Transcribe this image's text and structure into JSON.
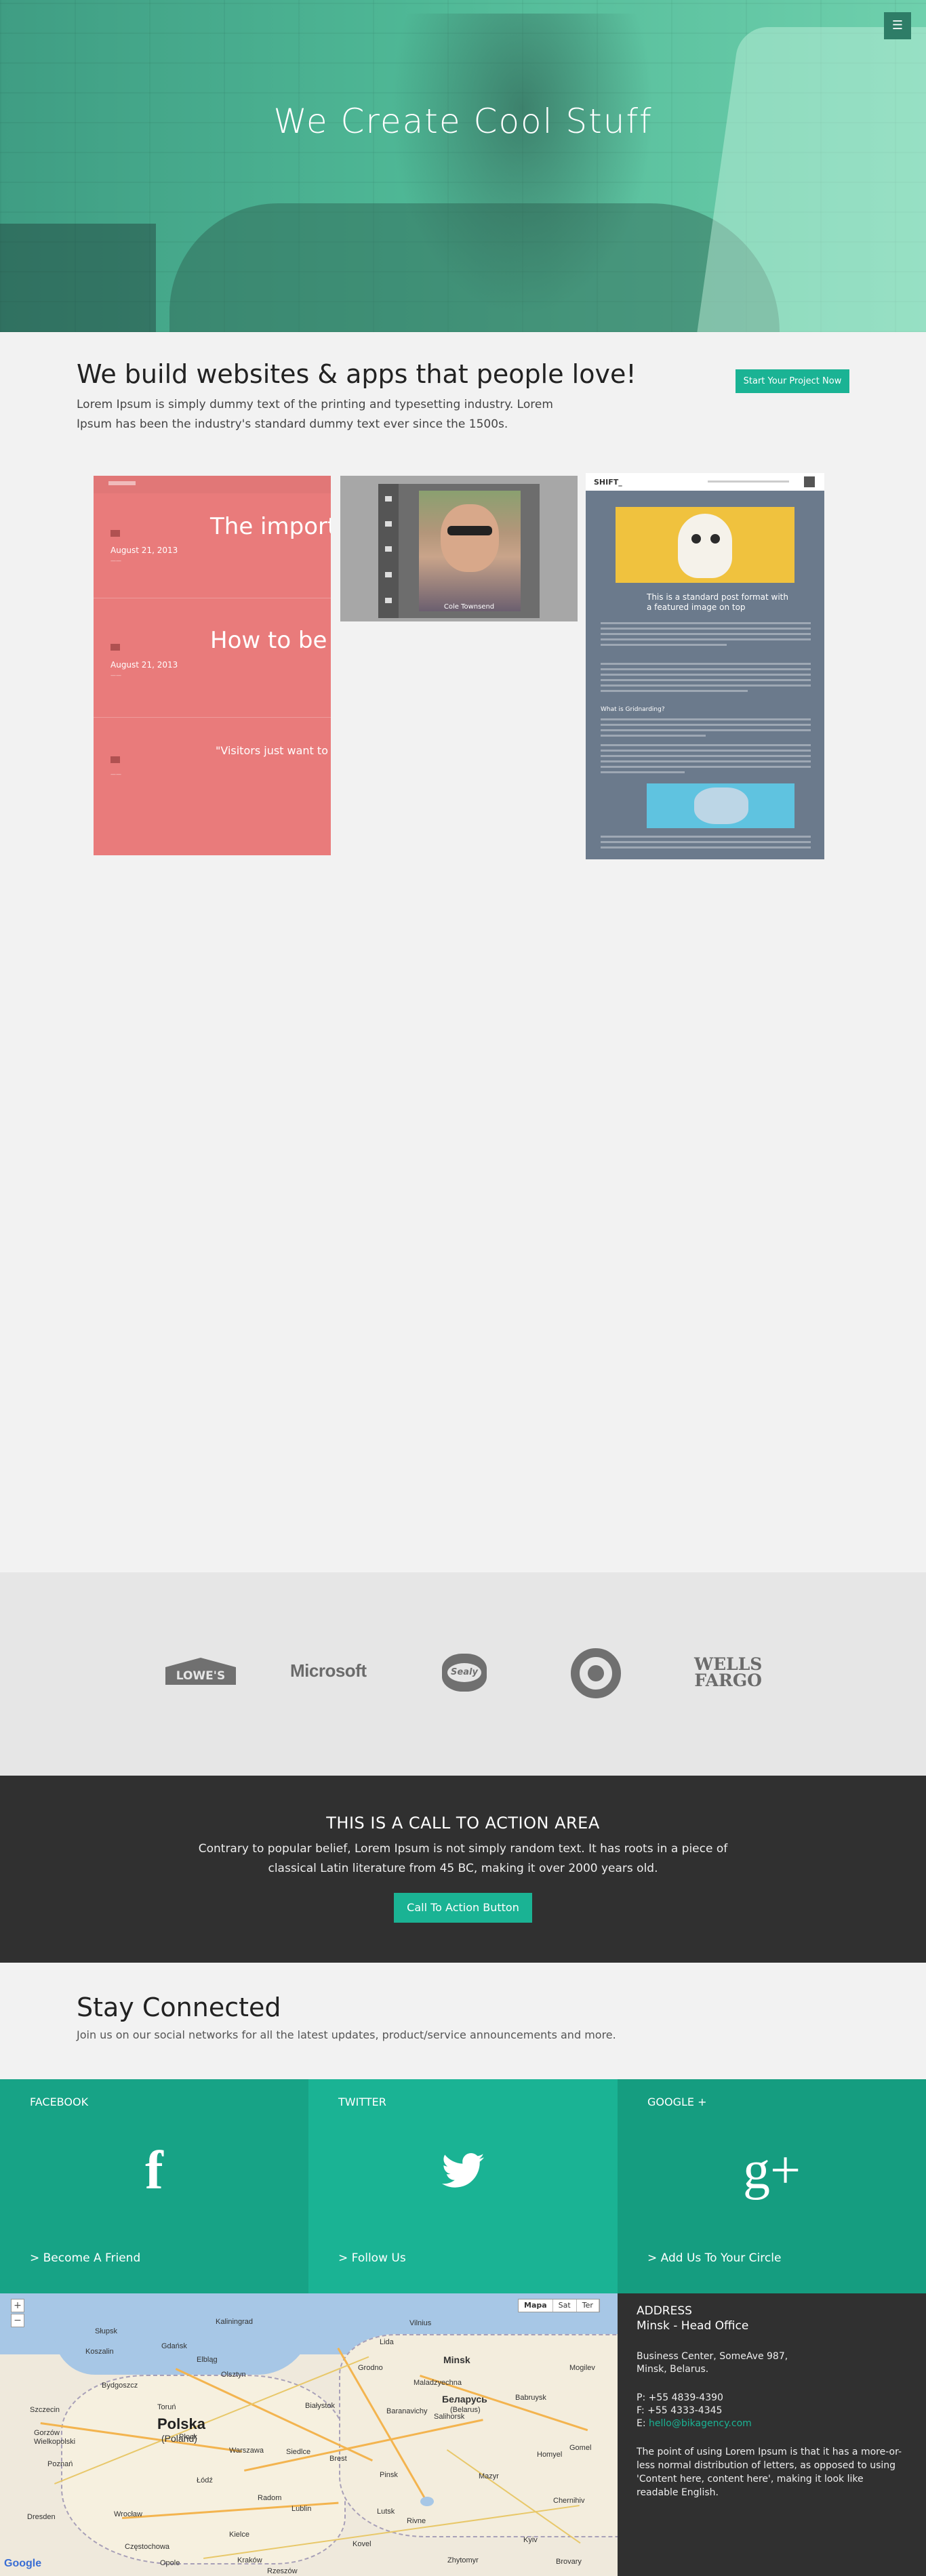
{
  "hero": {
    "title": "We Create Cool Stuff",
    "menu_icon": "☰"
  },
  "intro": {
    "heading": "We build websites & apps that people love!",
    "text": "Lorem Ipsum is simply dummy text of the printing and typesetting industry. Lorem Ipsum has been the industry's standard dummy text ever since the 1500s.",
    "button": "Start Your Project Now"
  },
  "portfolio": {
    "pink": {
      "date1": "August 21, 2013",
      "title1": "The importa typography",
      "date2": "August 21, 2013",
      "title2": "How to be o organized",
      "quote": "\"Visitors just want to c to your site for, why a try a"
    },
    "grey": {
      "caption": "Cole Townsend"
    },
    "blog": {
      "logo": "SHIFT_",
      "post_title": "This is a standard post format with a featured image on top",
      "section_head": "What is Gridnarding?"
    }
  },
  "clients": {
    "lowes": "LOWE'S",
    "microsoft": "Microsoft",
    "sealy": "Sealy",
    "wells_line1": "WELLS",
    "wells_line2": "FARGO"
  },
  "cta": {
    "heading": "THIS IS A CALL TO ACTION AREA",
    "text": "Contrary to popular belief, Lorem Ipsum is not simply random text. It has roots in a piece of classical Latin literature from 45 BC, making it over 2000 years old.",
    "button": "Call To Action Button"
  },
  "stay": {
    "heading": "Stay Connected",
    "text": "Join us on our social networks for all the latest updates, product/service announcements and more."
  },
  "social": [
    {
      "label": "FACEBOOK",
      "glyph": "f",
      "link": "> Become A Friend",
      "icon": "facebook-icon"
    },
    {
      "label": "TWITTER",
      "glyph": "🐦",
      "link": "> Follow Us",
      "icon": "twitter-icon"
    },
    {
      "label": "GOOGLE +",
      "glyph": "g+",
      "link": "> Add Us To Your Circle",
      "icon": "google-plus-icon"
    }
  ],
  "map": {
    "types": [
      "Mapa",
      "Sat",
      "Ter"
    ],
    "country_pl": "Polska",
    "country_pl_sub": "(Poland)",
    "country_by": "Беларусь",
    "country_by_sub": "(Belarus)",
    "cities": [
      "Kaliningrad",
      "Vilnius",
      "Gdańsk",
      "Olsztyn",
      "Szczecin",
      "Bydgoszcz",
      "Białystok",
      "Minsk",
      "Mogilev",
      "Poznań",
      "Warszawa",
      "Brest",
      "Gomel",
      "Łódź",
      "Lublin",
      "Wrocław",
      "Kraków",
      "Lutsk",
      "Rivne",
      "Zhytomyr",
      "Kyiv",
      "Chernihiv",
      "Grodno",
      "Baranavichy",
      "Pinsk",
      "Mazyr",
      "Koszalin",
      "Gorzów Wielkopolski",
      "Częstochowa",
      "Kielce",
      "Radom",
      "Opole",
      "Rzeszów",
      "Dresden",
      "Siedlce",
      "Babruysk",
      "Homyel",
      "Kovel",
      "Płock",
      "Słupsk",
      "Elbląg",
      "Toruń",
      "Lida",
      "Maladzyechna",
      "Salihorsk",
      "Brovary"
    ],
    "google": "Google",
    "zoom_in": "+",
    "zoom_out": "−"
  },
  "address": {
    "title": "ADDRESS",
    "office": "Minsk - Head Office",
    "line1": "Business Center, SomeAve 987,",
    "line2": "Minsk, Belarus.",
    "phone": "P: +55 4839-4390",
    "fax": "F: +55 4333-4345",
    "email_prefix": "E: ",
    "email": "hello@bikagency.com",
    "desc": "The point of using Lorem Ipsum is that it has a more-or-less normal distribution of letters, as opposed to using 'Content here, content here', making it look like readable English."
  },
  "colors": {
    "accent": "#1ab394",
    "dark": "#303030",
    "hero": "#4fb896",
    "facebook": "#17a386",
    "google": "#159d80"
  }
}
